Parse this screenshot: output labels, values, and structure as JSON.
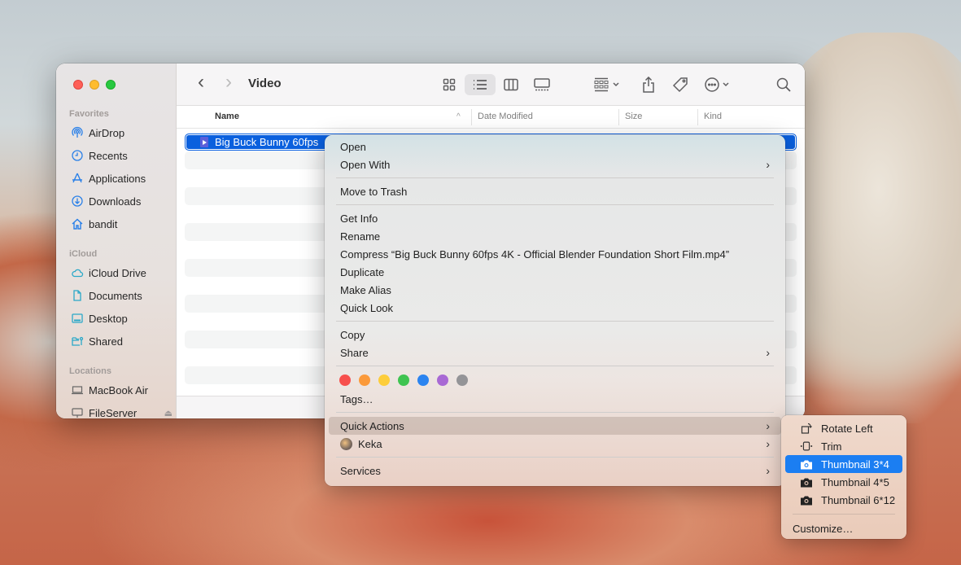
{
  "window": {
    "title": "Video",
    "traffic_lights": [
      "close",
      "minimize",
      "zoom"
    ]
  },
  "sidebar": {
    "sections": [
      {
        "label": "Favorites",
        "items": [
          {
            "label": "AirDrop",
            "icon": "airdrop-icon"
          },
          {
            "label": "Recents",
            "icon": "clock-icon"
          },
          {
            "label": "Applications",
            "icon": "applications-icon"
          },
          {
            "label": "Downloads",
            "icon": "download-icon"
          },
          {
            "label": "bandit",
            "icon": "home-icon"
          }
        ]
      },
      {
        "label": "iCloud",
        "items": [
          {
            "label": "iCloud Drive",
            "icon": "cloud-icon"
          },
          {
            "label": "Documents",
            "icon": "document-icon"
          },
          {
            "label": "Desktop",
            "icon": "desktop-icon"
          },
          {
            "label": "Shared",
            "icon": "shared-folder-icon"
          }
        ]
      },
      {
        "label": "Locations",
        "items": [
          {
            "label": "MacBook Air",
            "icon": "laptop-icon"
          },
          {
            "label": "FileServer",
            "icon": "display-icon",
            "eject": "⏏"
          }
        ]
      }
    ]
  },
  "toolbar": {
    "back": "‹",
    "forward": "›",
    "view_modes": [
      "icon",
      "list",
      "column",
      "gallery"
    ],
    "active_view": "list"
  },
  "columns": {
    "name": "Name",
    "sort_indicator": "^",
    "date_modified": "Date Modified",
    "size": "Size",
    "kind": "Kind"
  },
  "files": [
    {
      "name": "Big Buck Bunny 60fps",
      "selected": true
    }
  ],
  "context_menu": {
    "open": "Open",
    "open_with": "Open With",
    "move_to_trash": "Move to Trash",
    "get_info": "Get Info",
    "rename": "Rename",
    "compress": "Compress “Big Buck Bunny 60fps 4K - Official Blender Foundation Short Film.mp4”",
    "duplicate": "Duplicate",
    "make_alias": "Make Alias",
    "quick_look": "Quick Look",
    "copy": "Copy",
    "share": "Share",
    "tag_colors": [
      "#f74f4c",
      "#fb9a3a",
      "#fdcd3a",
      "#3fc451",
      "#2b84f0",
      "#a869d4",
      "#949497"
    ],
    "tags": "Tags…",
    "quick_actions": "Quick Actions",
    "keka": "Keka",
    "services": "Services",
    "chevron": "›"
  },
  "quick_actions_submenu": {
    "items": [
      {
        "label": "Rotate Left",
        "icon": "rotate-left-icon"
      },
      {
        "label": "Trim",
        "icon": "trim-icon"
      },
      {
        "label": "Thumbnail 3*4",
        "icon": "camera-icon",
        "active": true
      },
      {
        "label": "Thumbnail 4*5",
        "icon": "camera-icon"
      },
      {
        "label": "Thumbnail 6*12",
        "icon": "camera-icon"
      }
    ],
    "customize": "Customize…"
  },
  "colors": {
    "selection": "#0a60de",
    "submenu_active": "#1b7ef2",
    "sidebar_icon": "#2a80e8"
  }
}
